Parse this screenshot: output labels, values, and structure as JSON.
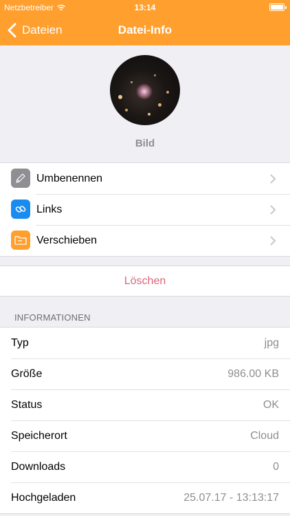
{
  "status_bar": {
    "carrier": "Netzbetreiber",
    "time": "13:14"
  },
  "nav": {
    "back_label": "Dateien",
    "title": "Datei-Info"
  },
  "file": {
    "name": "Bild"
  },
  "actions": [
    {
      "label": "Umbenennen",
      "icon": "pencil-icon",
      "color": "#8e8e93"
    },
    {
      "label": "Links",
      "icon": "link-icon",
      "color": "#1a8cf0"
    },
    {
      "label": "Verschieben",
      "icon": "folder-icon",
      "color": "#ff9f2e"
    }
  ],
  "delete_label": "Löschen",
  "info": {
    "header": "INFORMATIONEN",
    "rows": [
      {
        "label": "Typ",
        "value": "jpg"
      },
      {
        "label": "Größe",
        "value": "986.00 KB"
      },
      {
        "label": "Status",
        "value": "OK"
      },
      {
        "label": "Speicherort",
        "value": "Cloud"
      },
      {
        "label": "Downloads",
        "value": "0"
      },
      {
        "label": "Hochgeladen",
        "value": "25.07.17 - 13:13:17"
      }
    ]
  },
  "colors": {
    "accent": "#ff9f2e",
    "delete": "#d9667a",
    "background": "#efeff4"
  }
}
